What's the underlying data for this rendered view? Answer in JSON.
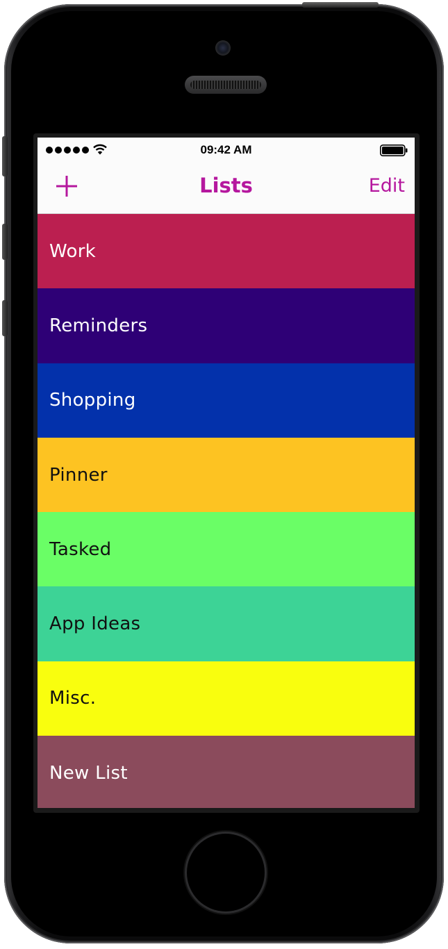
{
  "status": {
    "time": "09:42 AM"
  },
  "nav": {
    "title": "Lists",
    "edit_label": "Edit"
  },
  "colors": {
    "accent": "#b5179e"
  },
  "lists": [
    {
      "label": "Work",
      "color": "#bb1f50",
      "text_color": "#ffffff"
    },
    {
      "label": "Reminders",
      "color": "#2e0076",
      "text_color": "#ffffff"
    },
    {
      "label": "Shopping",
      "color": "#0331ab",
      "text_color": "#ffffff"
    },
    {
      "label": "Pinner",
      "color": "#fdc322",
      "text_color": "#111111"
    },
    {
      "label": "Tasked",
      "color": "#6afe66",
      "text_color": "#111111"
    },
    {
      "label": "App Ideas",
      "color": "#3dd396",
      "text_color": "#111111"
    },
    {
      "label": "Misc.",
      "color": "#f9fe0e",
      "text_color": "#111111"
    },
    {
      "label": "New List",
      "color": "#8b4b5c",
      "text_color": "#ffffff"
    }
  ]
}
